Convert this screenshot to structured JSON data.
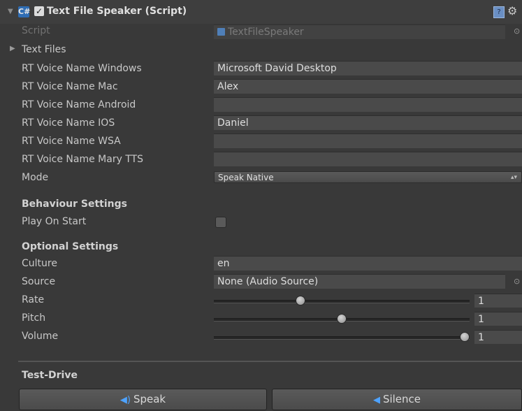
{
  "header": {
    "title": "Text File Speaker (Script)",
    "script_icon_glyph": "C#",
    "enabled_check": "✓"
  },
  "rows": {
    "script": {
      "label": "Script",
      "value": "TextFileSpeaker"
    },
    "text_files": {
      "label": "Text Files"
    },
    "voice_windows": {
      "label": "RT Voice Name Windows",
      "value": "Microsoft David Desktop"
    },
    "voice_mac": {
      "label": "RT Voice Name Mac",
      "value": "Alex"
    },
    "voice_android": {
      "label": "RT Voice Name Android",
      "value": ""
    },
    "voice_ios": {
      "label": "RT Voice Name IOS",
      "value": "Daniel"
    },
    "voice_wsa": {
      "label": "RT Voice Name WSA",
      "value": ""
    },
    "voice_marytts": {
      "label": "RT Voice Name Mary TTS",
      "value": ""
    },
    "mode": {
      "label": "Mode",
      "value": "Speak Native"
    }
  },
  "behaviour": {
    "title": "Behaviour Settings",
    "play_on_start": {
      "label": "Play On Start",
      "checked": false
    }
  },
  "optional": {
    "title": "Optional Settings",
    "culture": {
      "label": "Culture",
      "value": "en"
    },
    "source": {
      "label": "Source",
      "value": "None (Audio Source)"
    },
    "rate": {
      "label": "Rate",
      "value": "1",
      "slider_fraction": 0.333
    },
    "pitch": {
      "label": "Pitch",
      "value": "1",
      "slider_fraction": 0.5
    },
    "volume": {
      "label": "Volume",
      "value": "1",
      "slider_fraction": 1.0
    }
  },
  "test_drive": {
    "title": "Test-Drive",
    "speak_label": "Speak",
    "silence_label": "Silence"
  },
  "icons": {
    "collapse": "collapse-arrow-icon",
    "script_file": "csharp-script-icon",
    "help": "help-book-icon",
    "settings": "gear-icon",
    "object_picker": "object-picker-target-icon",
    "speaker": "speaker-icon"
  },
  "colors": {
    "background": "#393939",
    "header": "#3e3e3e",
    "field": "#4a4a4a",
    "accent_blue": "#4ea3ff"
  }
}
